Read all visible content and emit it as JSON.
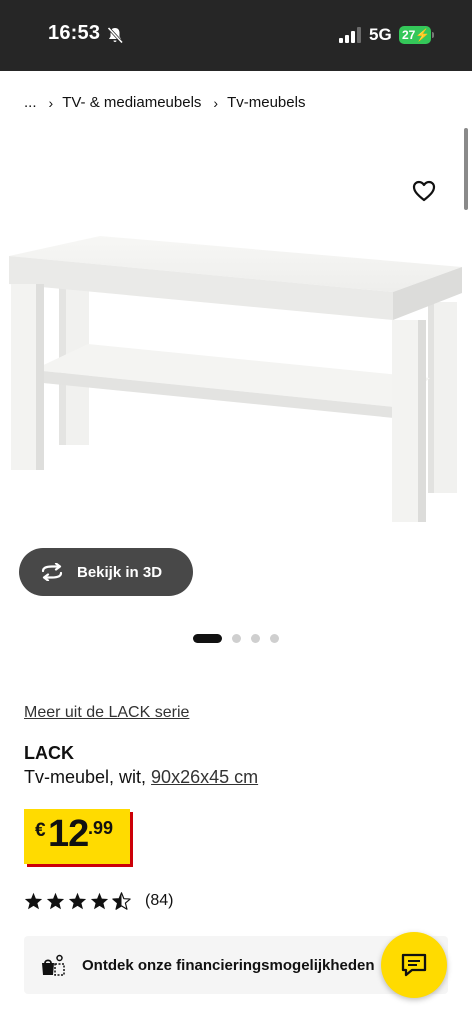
{
  "status_bar": {
    "time": "16:53",
    "network": "5G",
    "battery": "27"
  },
  "breadcrumb": {
    "items": [
      "...",
      "TV- & mediameubels",
      "Tv-meubels"
    ],
    "separator": "›"
  },
  "gallery": {
    "view_3d_label": "Bekijk in 3D",
    "image_count": 4,
    "active_index": 0
  },
  "product": {
    "series_link": "Meer uit de LACK serie",
    "name": "LACK",
    "description": "Tv-meubel, wit,",
    "dimensions": "90x26x45 cm",
    "price": {
      "currency": "€",
      "integer": "12",
      "decimal": ".99"
    },
    "rating": {
      "stars": 4.5,
      "max": 5,
      "count": "(84)"
    }
  },
  "financing": {
    "label": "Ontdek onze financieringsmogelijkheden"
  },
  "colors": {
    "status_bar": "#262626",
    "price_yellow": "#ffdb00",
    "price_shadow": "#cc0008",
    "battery_green": "#34c759",
    "button_3d": "#484848"
  },
  "icons": {
    "favorite": "heart-icon",
    "view_3d": "rotate-3d-icon",
    "financing": "financing-bag-icon",
    "chat": "chat-icon",
    "star": "star-icon"
  }
}
